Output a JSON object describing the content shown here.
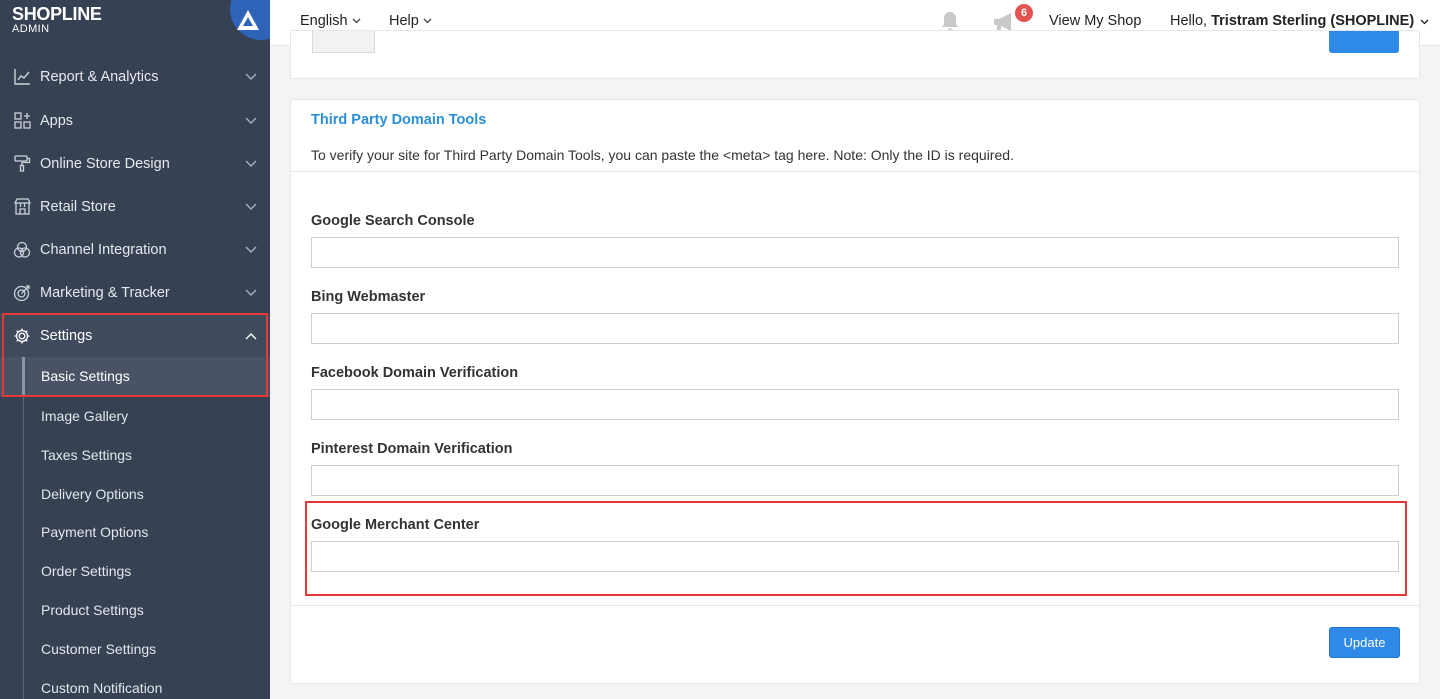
{
  "brand": {
    "logo_text": "SHOPLINE",
    "sub_text": "ADMIN"
  },
  "topbar": {
    "language": "English",
    "help": "Help",
    "notification_count": "6",
    "view_shop": "View My Shop",
    "greeting": "Hello,",
    "user": "Tristram Sterling (SHOPLINE)"
  },
  "sidebar": {
    "items": [
      {
        "label": "Report & Analytics",
        "icon": "chart-icon"
      },
      {
        "label": "Apps",
        "icon": "apps-grid-icon"
      },
      {
        "label": "Online Store Design",
        "icon": "paint-roller-icon"
      },
      {
        "label": "Retail Store",
        "icon": "store-icon"
      },
      {
        "label": "Channel Integration",
        "icon": "channels-icon"
      },
      {
        "label": "Marketing & Tracker",
        "icon": "target-icon"
      },
      {
        "label": "Settings",
        "icon": "gear-icon"
      }
    ],
    "settings_sub": [
      "Basic Settings",
      "Image Gallery",
      "Taxes Settings",
      "Delivery Options",
      "Payment Options",
      "Order Settings",
      "Product Settings",
      "Customer Settings",
      "Custom Notification"
    ]
  },
  "card": {
    "title": "Third Party Domain Tools",
    "description": "To verify your site for Third Party Domain Tools, you can paste the <meta> tag here. Note: Only the ID is required.",
    "fields": [
      {
        "label": "Google Search Console",
        "value": ""
      },
      {
        "label": "Bing Webmaster",
        "value": ""
      },
      {
        "label": "Facebook Domain Verification",
        "value": ""
      },
      {
        "label": "Pinterest Domain Verification",
        "value": ""
      },
      {
        "label": "Google Merchant Center",
        "value": ""
      }
    ],
    "update_label": "Update"
  },
  "colors": {
    "sidebar_bg": "#364154",
    "accent_blue": "#2e8ae6",
    "link_blue": "#2b8fd6",
    "highlight_red": "#e53935",
    "badge_red": "#e35252"
  }
}
